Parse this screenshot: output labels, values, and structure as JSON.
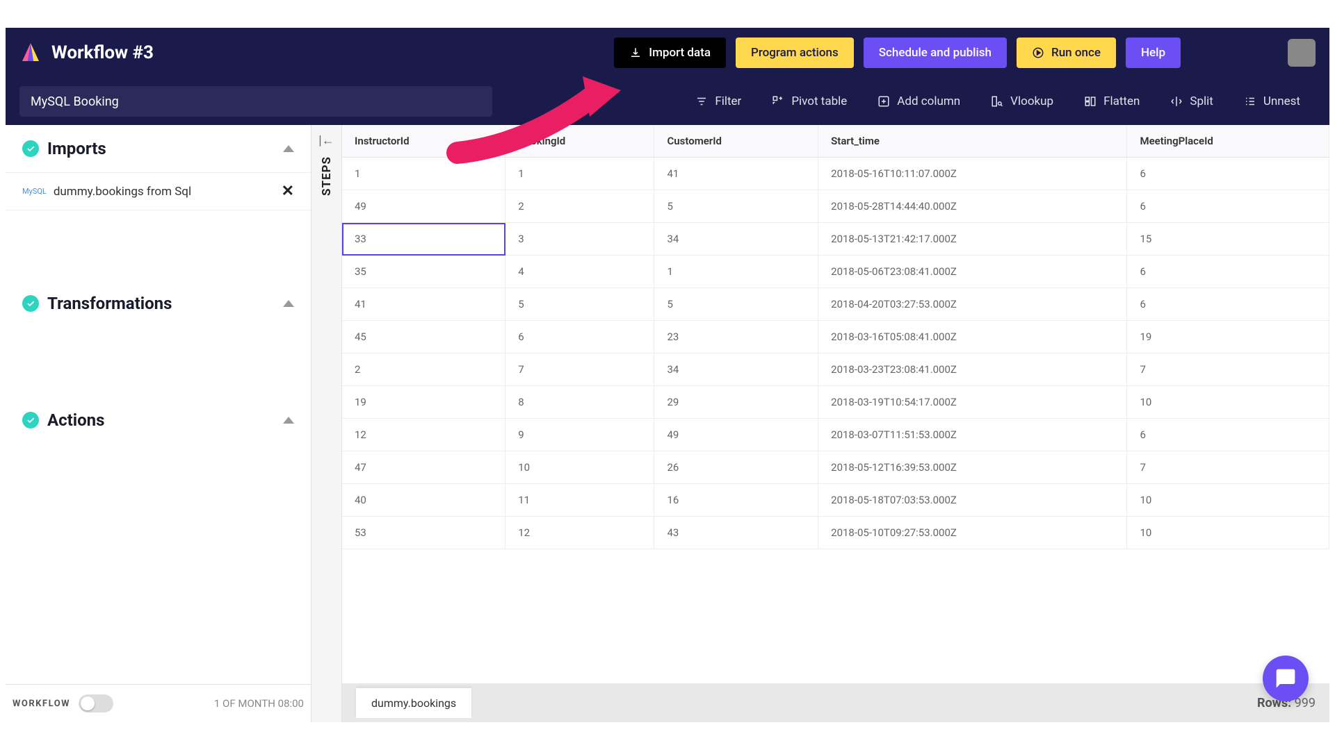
{
  "header": {
    "title": "Workflow #3",
    "import_label": "Import data",
    "program_actions": "Program actions",
    "schedule_publish": "Schedule and publish",
    "run_once": "Run once",
    "help": "Help"
  },
  "toolbar": {
    "search_value": "MySQL Booking",
    "filter": "Filter",
    "pivot": "Pivot table",
    "add_column": "Add column",
    "vlookup": "Vlookup",
    "flatten": "Flatten",
    "split": "Split",
    "unnest": "Unnest"
  },
  "sidebar": {
    "imports": {
      "title": "Imports",
      "items": [
        {
          "source": "MySQL",
          "label": "dummy.bookings from Sql"
        }
      ]
    },
    "transformations": {
      "title": "Transformations"
    },
    "actions": {
      "title": "Actions"
    },
    "footer": {
      "workflow": "WORKFLOW",
      "schedule": "1 OF MONTH 08:00"
    }
  },
  "steps_label": "STEPS",
  "table": {
    "columns": [
      "InstructorId",
      "BookingId",
      "CustomerId",
      "Start_time",
      "MeetingPlaceId"
    ],
    "rows": [
      [
        "1",
        "1",
        "41",
        "2018-05-16T10:11:07.000Z",
        "6"
      ],
      [
        "49",
        "2",
        "5",
        "2018-05-28T14:44:40.000Z",
        "6"
      ],
      [
        "33",
        "3",
        "34",
        "2018-05-13T21:42:17.000Z",
        "15"
      ],
      [
        "35",
        "4",
        "1",
        "2018-05-06T23:08:41.000Z",
        "6"
      ],
      [
        "41",
        "5",
        "5",
        "2018-04-20T03:27:53.000Z",
        "6"
      ],
      [
        "45",
        "6",
        "23",
        "2018-03-16T05:08:41.000Z",
        "19"
      ],
      [
        "2",
        "7",
        "34",
        "2018-03-23T23:08:41.000Z",
        "7"
      ],
      [
        "19",
        "8",
        "29",
        "2018-03-19T10:54:17.000Z",
        "10"
      ],
      [
        "12",
        "9",
        "49",
        "2018-03-07T11:51:53.000Z",
        "6"
      ],
      [
        "47",
        "10",
        "26",
        "2018-05-12T16:39:53.000Z",
        "7"
      ],
      [
        "40",
        "11",
        "16",
        "2018-05-18T07:03:53.000Z",
        "10"
      ],
      [
        "53",
        "12",
        "43",
        "2018-05-10T09:27:53.000Z",
        "10"
      ]
    ],
    "selected_cell": [
      2,
      0
    ]
  },
  "footer": {
    "dataset_tab": "dummy.bookings",
    "rows_label": "Rows:",
    "rows_count": "999"
  }
}
